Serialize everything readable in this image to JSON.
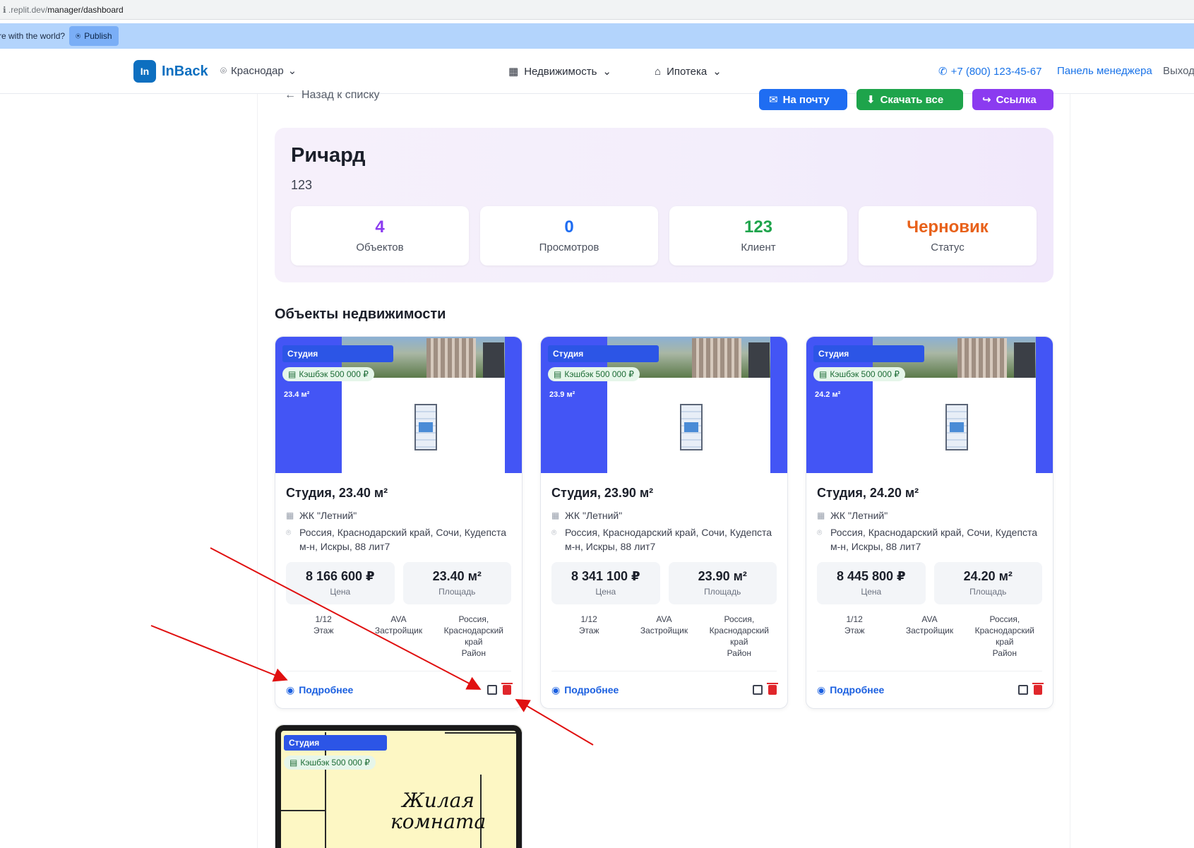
{
  "browser": {
    "url_prefix": "ℹ .replit.dev/",
    "url_path": "manager/dashboard"
  },
  "banner": {
    "text": "re with the world?",
    "publish_label": "Publish"
  },
  "header": {
    "logo_mark": "In",
    "logo_text": "InBack",
    "city": "Краснодар",
    "nav_realty": "Недвижимость",
    "nav_mortgage": "Ипотека",
    "phone": "+7 (800) 123-45-67",
    "manager_panel": "Панель менеджера",
    "logout": "Выход"
  },
  "toolbar": {
    "back": "Назад к списку",
    "mail": "На почту",
    "download": "Скачать все",
    "link": "Ссылка"
  },
  "collection": {
    "name": "Ричард",
    "subtitle": "123",
    "stats": [
      {
        "value": "4",
        "label": "Объектов",
        "color": "#8b3bf0"
      },
      {
        "value": "0",
        "label": "Просмотров",
        "color": "#1f6df2"
      },
      {
        "value": "123",
        "label": "Клиент",
        "color": "#1ea44b"
      },
      {
        "value": "Черновик",
        "label": "Статус",
        "color": "#e8611a"
      }
    ]
  },
  "section_title": "Объекты недвижимости",
  "cards": [
    {
      "type": "Студия",
      "cashback": "Кэшбэк 500 000 ₽",
      "img_area": "23.4 м²",
      "title": "Студия, 23.40 м²",
      "complex": "ЖК \"Летний\"",
      "address": "Россия, Краснодарский край, Сочи, Кудепста м-н, Искры, 88 лит7",
      "price": "8 166 600 ₽",
      "price_label": "Цена",
      "area": "23.40 м²",
      "area_label": "Площадь",
      "floor": "1/12",
      "floor_label": "Этаж",
      "developer": "AVA",
      "developer_label": "Застройщик",
      "district": "Россия, Краснодарский край",
      "district_label": "Район",
      "more": "Подробнее"
    },
    {
      "type": "Студия",
      "cashback": "Кэшбэк 500 000 ₽",
      "img_area": "23.9 м²",
      "title": "Студия, 23.90 м²",
      "complex": "ЖК \"Летний\"",
      "address": "Россия, Краснодарский край, Сочи, Кудепста м-н, Искры, 88 лит7",
      "price": "8 341 100 ₽",
      "price_label": "Цена",
      "area": "23.90 м²",
      "area_label": "Площадь",
      "floor": "1/12",
      "floor_label": "Этаж",
      "developer": "AVA",
      "developer_label": "Застройщик",
      "district": "Россия, Краснодарский край",
      "district_label": "Район",
      "more": "Подробнее"
    },
    {
      "type": "Студия",
      "cashback": "Кэшбэк 500 000 ₽",
      "img_area": "24.2 м²",
      "title": "Студия, 24.20 м²",
      "complex": "ЖК \"Летний\"",
      "address": "Россия, Краснодарский край, Сочи, Кудепста м-н, Искры, 88 лит7",
      "price": "8 445 800 ₽",
      "price_label": "Цена",
      "area": "24.20 м²",
      "area_label": "Площадь",
      "floor": "1/12",
      "floor_label": "Этаж",
      "developer": "AVA",
      "developer_label": "Застройщик",
      "district": "Россия, Краснодарский край",
      "district_label": "Район",
      "more": "Подробнее"
    }
  ],
  "card4": {
    "type": "Студия",
    "cashback": "Кэшбэк 500 000 ₽",
    "room_line1": "Жилая",
    "room_line2": "комната"
  },
  "colors": {
    "annotation": "#e01010",
    "accent": "#1a5fe0"
  }
}
